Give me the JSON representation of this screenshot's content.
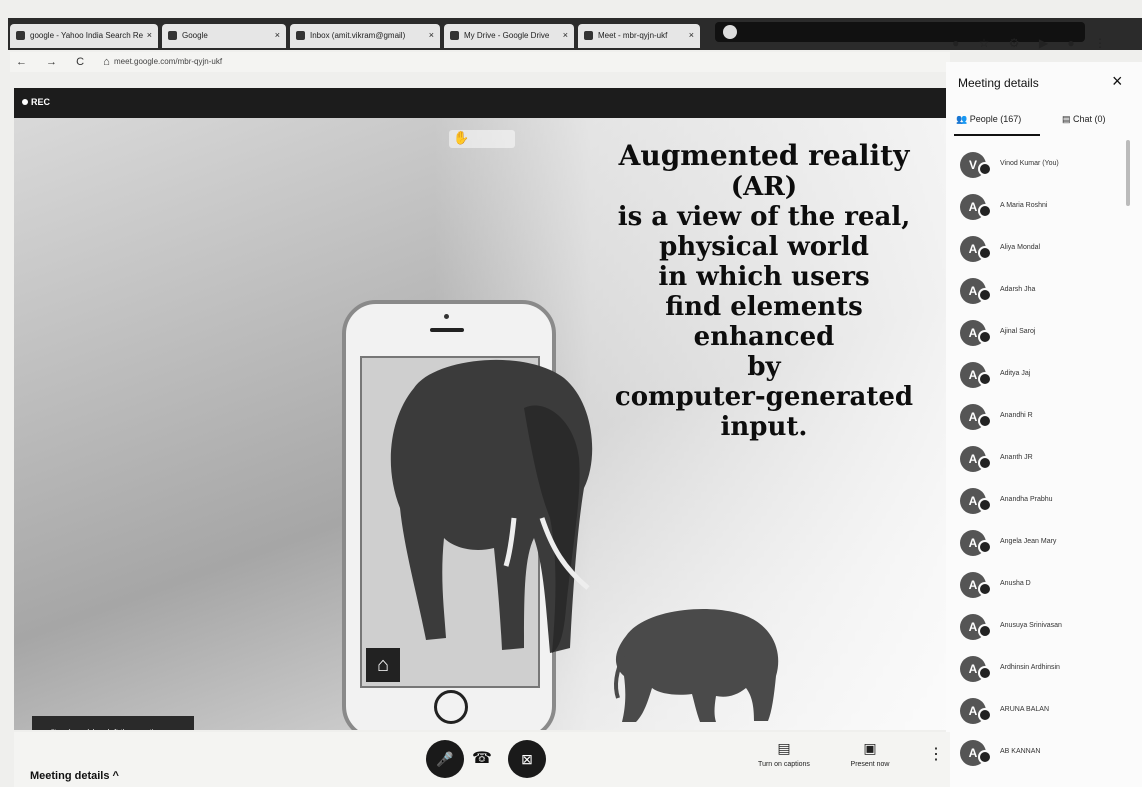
{
  "browser": {
    "tabs": [
      {
        "label": "google - Yahoo India Search Re"
      },
      {
        "label": "Google"
      },
      {
        "label": "Inbox (amit.vikram@gmail)"
      },
      {
        "label": "My Drive - Google Drive"
      },
      {
        "label": "Meet - mbr-qyjn-ukf"
      }
    ],
    "url": "meet.google.com/mbr-qyjn-ukf",
    "nav_icons": "← → C ⌂",
    "window_icons": "● ☆ ⚙ ▶ ● ⋮"
  },
  "meet": {
    "rec_label": "REC",
    "toast": "aditya (sona) has left the meeting",
    "meeting_details_label": "Meeting details ^"
  },
  "slide": {
    "lines": [
      "Augmented reality",
      "(AR)",
      "is a view of the real,",
      "physical world",
      "in which users",
      "find elements",
      "enhanced",
      "by",
      "computer-generated",
      "input."
    ]
  },
  "panel": {
    "title": "Meeting details",
    "close_icon": "×",
    "people_tab": "People (167)",
    "chat_tab": "Chat (0)",
    "people": [
      {
        "initial": "V",
        "name": "Vinod Kumar (You)"
      },
      {
        "initial": "A",
        "name": "A Maria Roshni"
      },
      {
        "initial": "A",
        "name": "Aliya Mondal"
      },
      {
        "initial": "A",
        "name": "Adarsh Jha"
      },
      {
        "initial": "A",
        "name": "Ajinal Saroj"
      },
      {
        "initial": "A",
        "name": "Aditya Jaj"
      },
      {
        "initial": "A",
        "name": "Anandhi R"
      },
      {
        "initial": "A",
        "name": "Ananth JR"
      },
      {
        "initial": "A",
        "name": "Anandha Prabhu"
      },
      {
        "initial": "A",
        "name": "Angela Jean Mary"
      },
      {
        "initial": "A",
        "name": "Anusha D"
      },
      {
        "initial": "A",
        "name": "Anusuya Srinivasan"
      },
      {
        "initial": "A",
        "name": "Ardhinsin Ardhinsin"
      },
      {
        "initial": "A",
        "name": "ARUNA BALAN"
      },
      {
        "initial": "A",
        "name": "AB KANNAN"
      }
    ]
  },
  "bottom": {
    "captions_label": "Turn on captions",
    "present_label": "Present now",
    "mic_icon": "🎤",
    "cam_icon": "⊠",
    "hangup_icon": "☎",
    "more_icon": "⋮",
    "captions_icon": "▤",
    "present_icon": "▣"
  }
}
